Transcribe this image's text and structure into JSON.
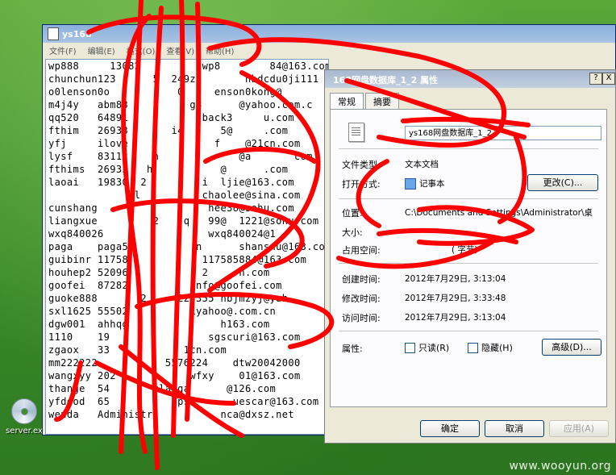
{
  "desktop": {
    "icon_label": "server.ex"
  },
  "notepad": {
    "title": "ys168",
    "menu": [
      "文件(F)",
      "编辑(E)",
      "格式(O)",
      "查看(V)",
      "帮助(H)"
    ],
    "lines": [
      "wp888     13082          wp8        84@163.com",
      "chunchun123      5  249z        hbdcdu0ji111",
      "o0lenson0o           0     enson0kong@",
      "m4j4y   abm83          g8      @yahoo.com.c",
      "qq520   64891            back3     u.com",
      "fthim   26933       i4      5@     .com",
      "yfj     ilove              f    @21cn.com",
      "lysf    83112    n             @a       com",
      "fthims  26933   h           @      .com",
      "laoai   19830  2         i  ljie@163.com",
      "              l          chaolee@sina.com",
      "cunshang                  hee38@sohu.com",
      "liangxue         2    q   99@  1221@sohu.com",
      "wxq840026                 wxq840024@1",
      "paga    paga5           n      shansnu@163.com",
      "guibinr 11758            117585884@163.com",
      "houhep2 52096            2     n.com",
      "goofei  87282           nfo@goofei.com",
      "guoke888       2     223355 hbjmzyj@yah",
      "sxl1625 55502          1yahoo@.com.cn",
      "dgw001  ahhqg               h163.com",
      "1110    19                sgscuri@163.com",
      "zgaox   33            1cn.com",
      "mm222222           5576224    dtw20042000",
      "wangxyy 202            wfxy    01@163.com",
      "thange  54       tlanga      @126.com",
      "yfdgod  65           ps       uescar@163.com",
      "wenda   Administr           nca@dxsz.net"
    ]
  },
  "dialog": {
    "title": "168网盘数据库_1_2         属性",
    "help_btn": "?",
    "close_btn": "X",
    "tabs": [
      "常规",
      "摘要"
    ],
    "filename": "ys168网盘数据库_1_2",
    "labels": {
      "type": "文件类型:",
      "open_with": "打开方式:",
      "location": "位置:",
      "size": "大小:",
      "size_on_disk": "占用空间:",
      "created": "创建时间:",
      "modified": "修改时间:",
      "accessed": "访问时间:",
      "attributes": "属性:"
    },
    "values": {
      "type": "文本文档",
      "open_with": "记事本",
      "location": "C:\\Documents and Settings\\Administrator\\桌",
      "size": "",
      "size_on_disk": "(         字节)",
      "created": "2012年7月29日, 3:13:04",
      "modified": "2012年7月29日, 3:33:48",
      "accessed": "2012年7月29日, 3:13:04"
    },
    "buttons": {
      "change": "更改(C)...",
      "advanced": "高级(D)...",
      "ok": "确定",
      "cancel": "取消",
      "apply": "应用(A)"
    },
    "attributes": {
      "readonly": "只读(R)",
      "hidden": "隐藏(H)"
    }
  },
  "watermark": "www.wooyun.org"
}
